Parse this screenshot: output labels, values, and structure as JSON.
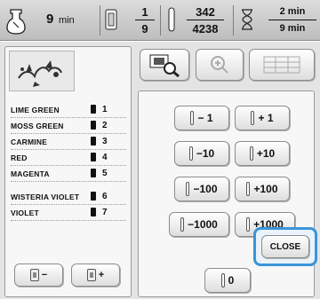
{
  "status": {
    "time_left_value": "9",
    "time_left_unit": "min",
    "color_numerator": "1",
    "color_denominator": "9",
    "stitch_numerator": "342",
    "stitch_denominator": "4238",
    "time_top": "2 min",
    "time_bottom": "9 min"
  },
  "colors": [
    {
      "name": "LIME GREEN",
      "num": "1"
    },
    {
      "name": "MOSS GREEN",
      "num": "2"
    },
    {
      "name": "CARMINE",
      "num": "3"
    },
    {
      "name": "RED",
      "num": "4"
    },
    {
      "name": "MAGENTA",
      "num": "5"
    },
    {
      "name": "WISTERIA VIOLET",
      "num": "6"
    },
    {
      "name": "VIOLET",
      "num": "7"
    }
  ],
  "adjust": {
    "minus1": "− 1",
    "plus1": "+ 1",
    "minus10": "−10",
    "plus10": "+10",
    "minus100": "−100",
    "plus100": "+100",
    "minus1000": "−1000",
    "plus1000": "+1000",
    "zero": "0"
  },
  "close_label": "CLOSE",
  "spool_minus": "−",
  "spool_plus": "+"
}
